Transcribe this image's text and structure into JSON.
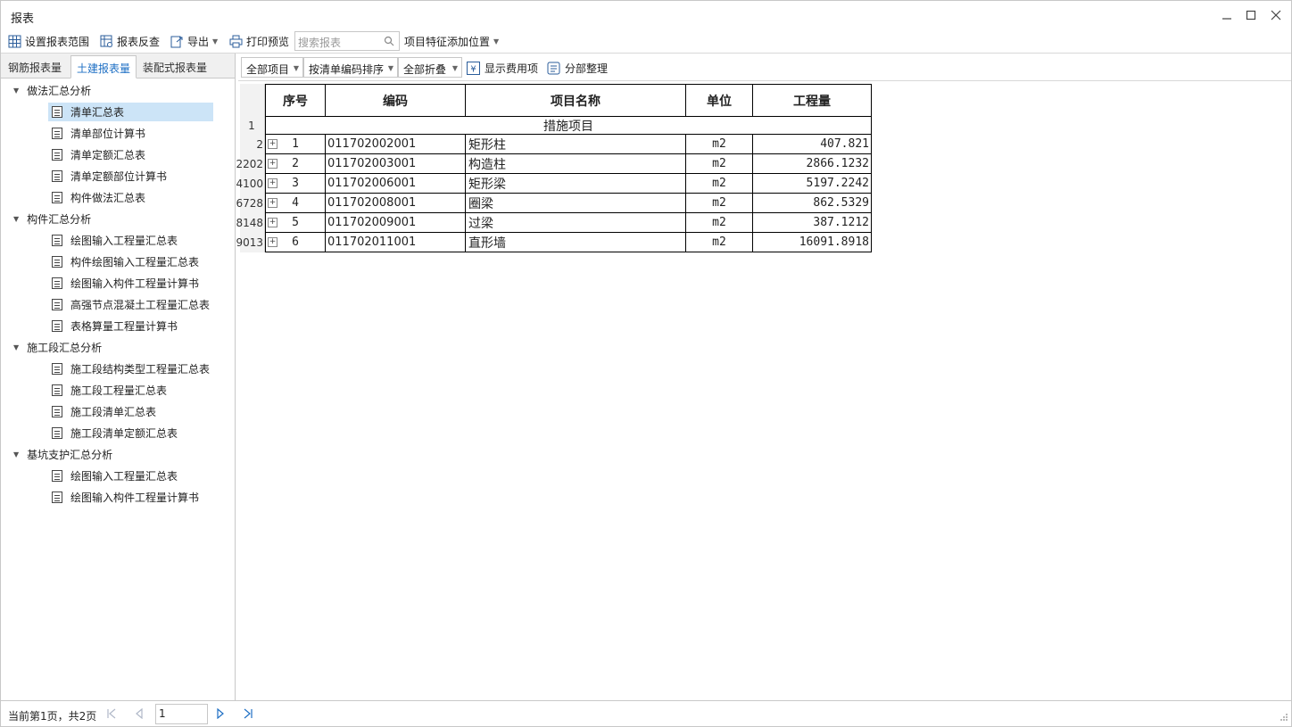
{
  "window": {
    "title": "报表"
  },
  "toolbar": {
    "set_range": "设置报表范围",
    "reverse_check": "报表反查",
    "export": "导出",
    "print_preview": "打印预览",
    "search_placeholder": "搜索报表",
    "feature_position": "项目特征添加位置"
  },
  "tabs": [
    "钢筋报表量",
    "土建报表量",
    "装配式报表量"
  ],
  "active_tab": "土建报表量",
  "tree": [
    {
      "group": "做法汇总分析",
      "items": [
        "清单汇总表",
        "清单部位计算书",
        "清单定额汇总表",
        "清单定额部位计算书",
        "构件做法汇总表"
      ]
    },
    {
      "group": "构件汇总分析",
      "items": [
        "绘图输入工程量汇总表",
        "构件绘图输入工程量汇总表",
        "绘图输入构件工程量计算书",
        "高强节点混凝土工程量汇总表",
        "表格算量工程量计算书"
      ]
    },
    {
      "group": "施工段汇总分析",
      "items": [
        "施工段结构类型工程量汇总表",
        "施工段工程量汇总表",
        "施工段清单汇总表",
        "施工段清单定额汇总表"
      ]
    },
    {
      "group": "基坑支护汇总分析",
      "items": [
        "绘图输入工程量汇总表",
        "绘图输入构件工程量计算书"
      ]
    }
  ],
  "selected_item": "清单汇总表",
  "subtoolbar": {
    "all_items": "全部项目",
    "sort_by_code": "按清单编码排序",
    "collapse_all": "全部折叠",
    "show_cost_items": "显示费用项",
    "section_arrange": "分部整理"
  },
  "table": {
    "headers": [
      "序号",
      "编码",
      "项目名称",
      "单位",
      "工程量"
    ],
    "section_row_num": "1",
    "section_title": "措施项目",
    "rows": [
      {
        "rownum": "2",
        "seq": "1",
        "code": "011702002001",
        "name": "矩形柱",
        "unit": "m2",
        "qty": "407.821"
      },
      {
        "rownum": "2202",
        "seq": "2",
        "code": "011702003001",
        "name": "构造柱",
        "unit": "m2",
        "qty": "2866.1232"
      },
      {
        "rownum": "4100",
        "seq": "3",
        "code": "011702006001",
        "name": "矩形梁",
        "unit": "m2",
        "qty": "5197.2242"
      },
      {
        "rownum": "6728",
        "seq": "4",
        "code": "011702008001",
        "name": "圈梁",
        "unit": "m2",
        "qty": "862.5329"
      },
      {
        "rownum": "8148",
        "seq": "5",
        "code": "011702009001",
        "name": "过梁",
        "unit": "m2",
        "qty": "387.1212"
      },
      {
        "rownum": "9013",
        "seq": "6",
        "code": "011702011001",
        "name": "直形墙",
        "unit": "m2",
        "qty": "16091.8918"
      }
    ]
  },
  "status": {
    "page_text": "当前第1页，共2页",
    "page_input": "1"
  },
  "colors": {
    "accent": "#1e6fc4",
    "selected_bg": "#cce4f7"
  }
}
